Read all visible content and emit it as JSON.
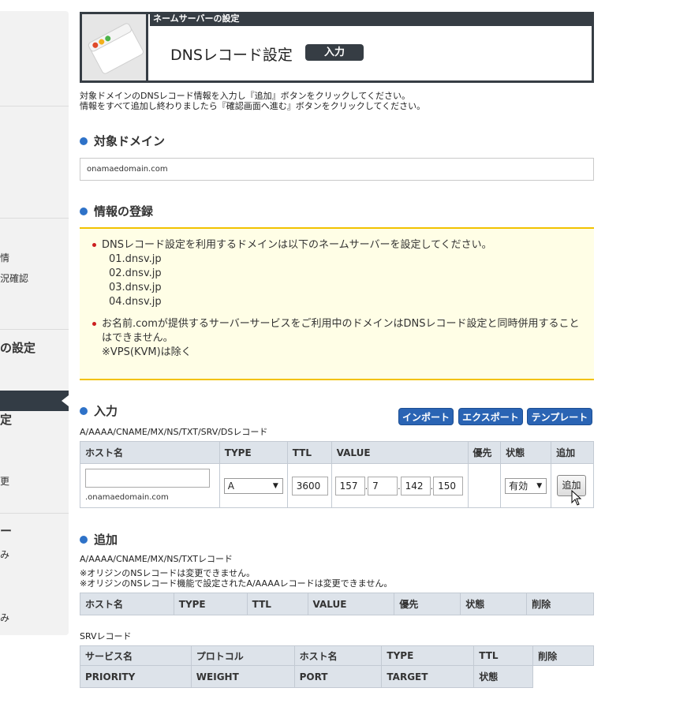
{
  "sidebar": {
    "items": [
      "情",
      "況確認",
      "の設定",
      "定",
      "更",
      "ー",
      "み",
      "み"
    ]
  },
  "header": {
    "section_label": "ネームサーバーの設定",
    "title": "DNSレコード設定",
    "badge": "入力"
  },
  "intro": {
    "line1": "対象ドメインのDNSレコード情報を入力し『追加』ボタンをクリックしてください。",
    "line2": "情報をすべて追加し終わりましたら『確認画面へ進む』ボタンをクリックしてください。"
  },
  "target_domain": {
    "heading": "対象ドメイン",
    "value": "onamaedomain.com"
  },
  "registration": {
    "heading": "情報の登録",
    "notice1": "DNSレコード設定を利用するドメインは以下のネームサーバーを設定してください。",
    "nameservers": [
      "01.dnsv.jp",
      "02.dnsv.jp",
      "03.dnsv.jp",
      "04.dnsv.jp"
    ],
    "notice2_line1": "お名前.comが提供するサーバーサービスをご利用中のドメインはDNSレコード設定と同時併用すること",
    "notice2_line2": "はできません。",
    "notice2_line3": "※VPS(KVM)は除く"
  },
  "input_section": {
    "heading": "入力",
    "buttons": {
      "import": "インポート",
      "export": "エクスポート",
      "template": "テンプレート"
    },
    "caption": "A/AAAA/CNAME/MX/NS/TXT/SRV/DSレコード",
    "columns": [
      "ホスト名",
      "TYPE",
      "TTL",
      "VALUE",
      "優先",
      "状態",
      "追加"
    ],
    "host_value": "",
    "host_suffix": ".onamaedomain.com",
    "type_value": "A",
    "ttl_value": "3600",
    "ip": [
      "157",
      "7",
      "142",
      "150"
    ],
    "ip_sep": ".",
    "status_value": "有効",
    "add_button": "追加"
  },
  "add_section": {
    "heading": "追加",
    "caption": "A/AAAA/CNAME/MX/NS/TXTレコード",
    "note1": "※オリジンのNSレコードは変更できません。",
    "note2": "※オリジンのNSレコード機能で設定されたA/AAAAレコードは変更できません。",
    "columns": [
      "ホスト名",
      "TYPE",
      "TTL",
      "VALUE",
      "優先",
      "状態",
      "削除"
    ]
  },
  "srv_section": {
    "caption": "SRVレコード",
    "row1": [
      "サービス名",
      "プロトコル",
      "ホスト名",
      "TYPE",
      "TTL",
      "削除"
    ],
    "row2": [
      "PRIORITY",
      "WEIGHT",
      "PORT",
      "TARGET",
      "状態"
    ]
  },
  "colors": {
    "dark_header": "#363d44",
    "accent_blue": "#2a64b4",
    "notice_bg": "#fffee6",
    "notice_border": "#f2c200"
  }
}
